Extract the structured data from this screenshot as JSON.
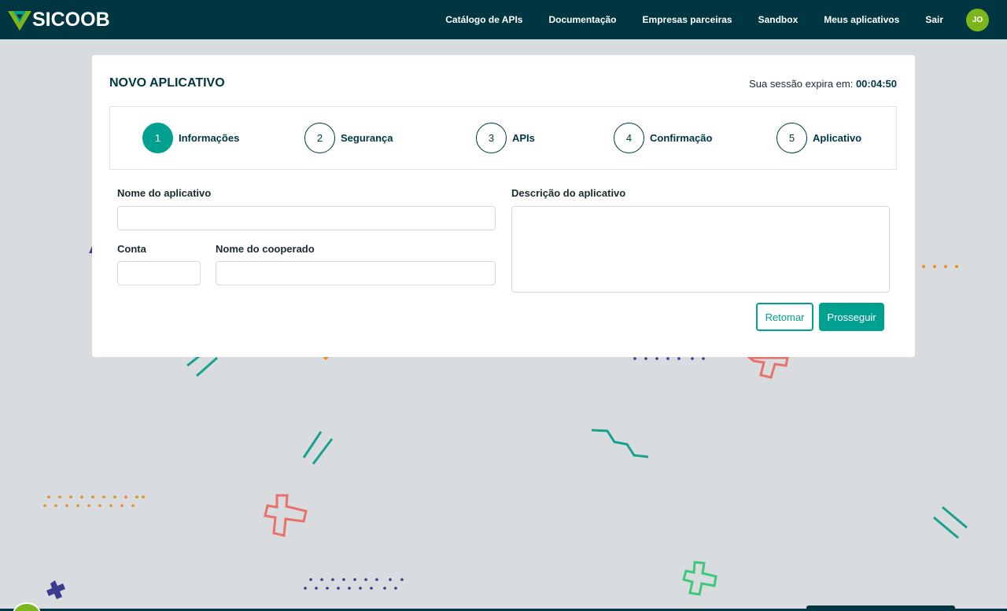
{
  "header": {
    "brand": "SICOOB",
    "nav": [
      "Catálogo de APIs",
      "Documentação",
      "Empresas parceiras",
      "Sandbox",
      "Meus aplicativos",
      "Sair"
    ],
    "avatar_initials": "JO"
  },
  "card": {
    "title": "NOVO APLICATIVO",
    "session_label": "Sua sessão expira em:",
    "session_time": "00:04:50"
  },
  "stepper": {
    "active_step": 1,
    "steps": [
      {
        "number": "1",
        "label": "Informações"
      },
      {
        "number": "2",
        "label": "Segurança"
      },
      {
        "number": "3",
        "label": "APIs"
      },
      {
        "number": "4",
        "label": "Confirmação"
      },
      {
        "number": "5",
        "label": "Aplicativo"
      }
    ]
  },
  "form": {
    "app_name_label": "Nome do aplicativo",
    "app_name_value": "",
    "account_label": "Conta",
    "account_value": "",
    "member_name_label": "Nome do cooperado",
    "member_name_value": "",
    "description_label": "Descrição do aplicativo",
    "description_value": ""
  },
  "actions": {
    "back_label": "Retomar",
    "next_label": "Prosseguir"
  },
  "colors": {
    "header_bg": "#003641",
    "accent": "#00a091",
    "avatar": "#7db61c",
    "background": "#d8dcdf"
  }
}
